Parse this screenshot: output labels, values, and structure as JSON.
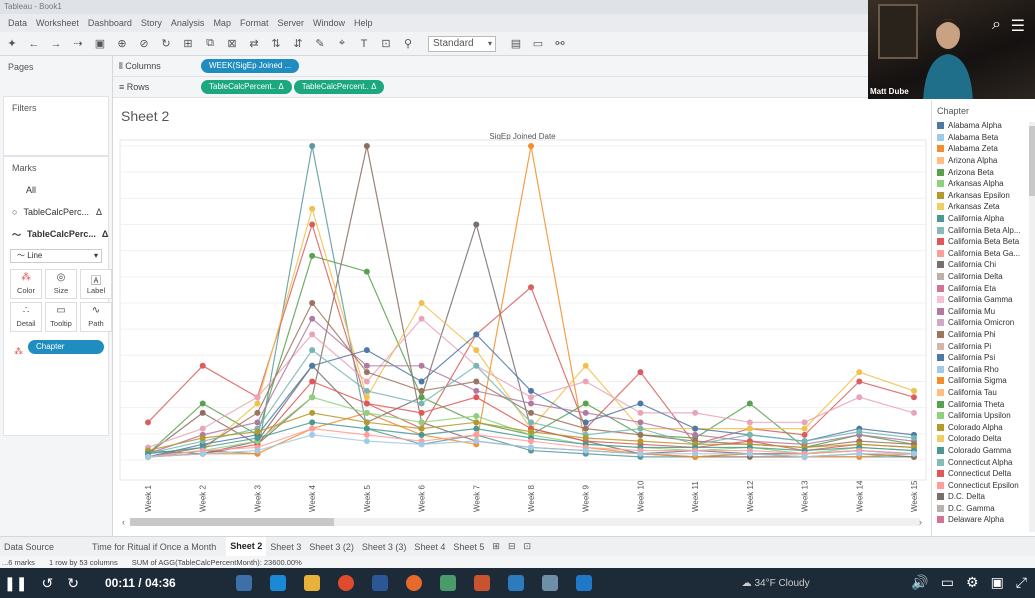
{
  "window": {
    "title": "Tableau - Book1"
  },
  "menu": [
    "Data",
    "Worksheet",
    "Dashboard",
    "Story",
    "Analysis",
    "Map",
    "Format",
    "Server",
    "Window",
    "Help"
  ],
  "toolbar": {
    "fit_label": "Standard"
  },
  "panes": {
    "pages": "Pages",
    "filters": "Filters",
    "marks": "Marks"
  },
  "marks": {
    "all": "All",
    "items": [
      {
        "label": "TableCalcPerc...",
        "delta": "Δ"
      },
      {
        "label": "TableCalcPerc...",
        "delta": "Δ"
      }
    ],
    "mark_type": "Line",
    "buttons": [
      "Color",
      "Size",
      "Label",
      "Detail",
      "Tooltip",
      "Path"
    ],
    "chapter_pill": "Chapter"
  },
  "shelves": {
    "columns_label": "Columns",
    "rows_label": "Rows",
    "columns_pill": "WEEK(SigEp Joined ...",
    "rows_pills": [
      "TableCalcPercent.. Δ",
      "TableCalcPercent.. Δ"
    ]
  },
  "sheet": {
    "title": "Sheet 2"
  },
  "chart_data": {
    "type": "line",
    "title": "SigEp Joined Date",
    "categories": [
      "Week 1",
      "Week 2",
      "Week 3",
      "Week 4",
      "Week 5",
      "Week 6",
      "Week 7",
      "Week 8",
      "Week 9",
      "Week 10",
      "Week 11",
      "Week 12",
      "Week 13",
      "Week 14",
      "Week 15"
    ],
    "ylim": [
      0,
      100
    ],
    "grid": true,
    "legend_position": "right",
    "series": [
      {
        "values": [
          1,
          3,
          2,
          100,
          10,
          5,
          8,
          3,
          2,
          1,
          1,
          2,
          1,
          1,
          1
        ],
        "color": "#5b9a9b"
      },
      {
        "values": [
          2,
          15,
          5,
          20,
          100,
          12,
          6,
          4,
          3,
          2,
          1,
          1,
          1,
          2,
          1
        ],
        "color": "#8c6d62"
      },
      {
        "values": [
          1,
          2,
          2,
          10,
          15,
          8,
          5,
          100,
          4,
          2,
          1,
          2,
          1,
          1,
          2
        ],
        "color": "#f28e2b"
      },
      {
        "values": [
          3,
          2,
          6,
          30,
          12,
          20,
          75,
          10,
          6,
          2,
          3,
          2,
          2,
          3,
          2
        ],
        "color": "#79706e"
      },
      {
        "values": [
          12,
          30,
          20,
          75,
          18,
          10,
          40,
          55,
          10,
          28,
          5,
          10,
          8,
          25,
          20
        ],
        "color": "#d95f5f"
      },
      {
        "values": [
          2,
          18,
          8,
          65,
          60,
          20,
          12,
          8,
          18,
          8,
          7,
          18,
          4,
          8,
          5
        ],
        "color": "#59a14f"
      },
      {
        "values": [
          1,
          3,
          18,
          80,
          20,
          50,
          35,
          10,
          30,
          10,
          10,
          10,
          10,
          28,
          22
        ],
        "color": "#f1c14e"
      },
      {
        "values": [
          4,
          10,
          20,
          40,
          25,
          45,
          30,
          20,
          25,
          15,
          15,
          12,
          12,
          20,
          15
        ],
        "color": "#e8a5b8"
      },
      {
        "values": [
          1,
          5,
          8,
          30,
          35,
          25,
          40,
          22,
          12,
          18,
          10,
          8,
          6,
          10,
          8
        ],
        "color": "#4e79a7"
      },
      {
        "values": [
          2,
          8,
          12,
          45,
          30,
          30,
          22,
          18,
          15,
          12,
          8,
          6,
          5,
          8,
          6
        ],
        "color": "#b07aa1"
      },
      {
        "values": [
          1,
          4,
          15,
          50,
          28,
          22,
          25,
          15,
          10,
          8,
          6,
          5,
          4,
          6,
          5
        ],
        "color": "#9c755f"
      },
      {
        "values": [
          2,
          6,
          10,
          35,
          22,
          18,
          30,
          12,
          8,
          10,
          5,
          8,
          6,
          9,
          7
        ],
        "color": "#76b7b2"
      },
      {
        "values": [
          1,
          2,
          5,
          25,
          18,
          15,
          20,
          10,
          6,
          5,
          4,
          6,
          3,
          5,
          4
        ],
        "color": "#e15759"
      },
      {
        "values": [
          1,
          3,
          6,
          20,
          15,
          12,
          14,
          8,
          5,
          4,
          3,
          4,
          2,
          4,
          3
        ],
        "color": "#8cd17d"
      },
      {
        "values": [
          3,
          7,
          9,
          15,
          12,
          10,
          12,
          9,
          7,
          6,
          5,
          5,
          4,
          5,
          4
        ],
        "color": "#b6992d"
      },
      {
        "values": [
          2,
          4,
          7,
          12,
          10,
          8,
          10,
          7,
          5,
          4,
          4,
          4,
          3,
          4,
          3
        ],
        "color": "#499894"
      },
      {
        "values": [
          1,
          3,
          4,
          10,
          8,
          6,
          8,
          6,
          4,
          3,
          3,
          3,
          2,
          3,
          2
        ],
        "color": "#ff9d9a"
      },
      {
        "values": [
          1,
          2,
          3,
          8,
          6,
          5,
          6,
          4,
          3,
          2,
          2,
          2,
          1,
          2,
          2
        ],
        "color": "#a0cbe8"
      }
    ]
  },
  "legend": {
    "title": "Chapter",
    "items": [
      {
        "label": "Alabama Alpha",
        "color": "#4e79a7"
      },
      {
        "label": "Alabama Beta",
        "color": "#a0cbe8"
      },
      {
        "label": "Alabama Zeta",
        "color": "#f28e2b"
      },
      {
        "label": "Arizona Alpha",
        "color": "#ffbe7d"
      },
      {
        "label": "Arizona Beta",
        "color": "#59a14f"
      },
      {
        "label": "Arkansas Alpha",
        "color": "#8cd17d"
      },
      {
        "label": "Arkansas Epsilon",
        "color": "#b6992d"
      },
      {
        "label": "Arkansas Zeta",
        "color": "#f1ce63"
      },
      {
        "label": "California Alpha",
        "color": "#499894"
      },
      {
        "label": "California Beta Alp...",
        "color": "#86bcb6"
      },
      {
        "label": "California Beta Beta",
        "color": "#e15759"
      },
      {
        "label": "California Beta Ga...",
        "color": "#ff9d9a"
      },
      {
        "label": "California Chi",
        "color": "#79706e"
      },
      {
        "label": "California Delta",
        "color": "#bab0ac"
      },
      {
        "label": "California Eta",
        "color": "#d37295"
      },
      {
        "label": "California Gamma",
        "color": "#fabfd2"
      },
      {
        "label": "California Mu",
        "color": "#b07aa1"
      },
      {
        "label": "California Omicron",
        "color": "#d4a6c8"
      },
      {
        "label": "California Phi",
        "color": "#9d7660"
      },
      {
        "label": "California Pi",
        "color": "#d7b5a6"
      },
      {
        "label": "California Psi",
        "color": "#4e79a7"
      },
      {
        "label": "California Rho",
        "color": "#a0cbe8"
      },
      {
        "label": "California Sigma",
        "color": "#f28e2b"
      },
      {
        "label": "California Tau",
        "color": "#ffbe7d"
      },
      {
        "label": "California Theta",
        "color": "#59a14f"
      },
      {
        "label": "California Upsilon",
        "color": "#8cd17d"
      },
      {
        "label": "Colorado Alpha",
        "color": "#b6992d"
      },
      {
        "label": "Colorado Delta",
        "color": "#f1ce63"
      },
      {
        "label": "Colorado Gamma",
        "color": "#499894"
      },
      {
        "label": "Connecticut Alpha",
        "color": "#86bcb6"
      },
      {
        "label": "Connecticut Delta",
        "color": "#e15759"
      },
      {
        "label": "Connecticut Epsilon",
        "color": "#ff9d9a"
      },
      {
        "label": "D.C. Delta",
        "color": "#79706e"
      },
      {
        "label": "D.C. Gamma",
        "color": "#bab0ac"
      },
      {
        "label": "Delaware Alpha",
        "color": "#d37295"
      }
    ]
  },
  "webcam": {
    "name": "Matt Dube"
  },
  "tabs": [
    "Data Source",
    "Time for Ritual if Once a Month",
    "Sheet 2",
    "Sheet 3",
    "Sheet 3 (2)",
    "Sheet 3 (3)",
    "Sheet 4",
    "Sheet 5"
  ],
  "active_tab": "Sheet 2",
  "status": {
    "marks": "...6 marks",
    "rows_cols": "1 row by 53 columns",
    "sum": "SUM of AGG(TableCalcPercentMonth): 23600.00%"
  },
  "player": {
    "time": "00:11 / 04:36"
  },
  "taskbar": {
    "weather": "34°F  Cloudy"
  }
}
